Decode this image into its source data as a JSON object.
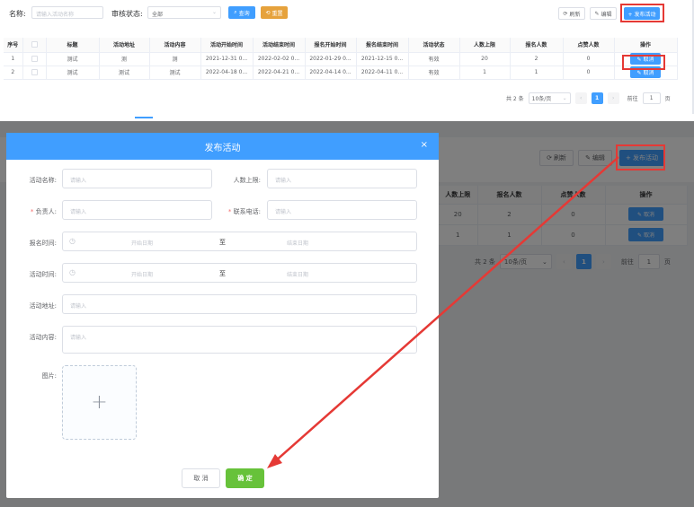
{
  "search": {
    "name_label": "名称:",
    "name_placeholder": "请输入活动名称",
    "status_label": "审核状态:",
    "status_value": "全部",
    "query_label": "查询",
    "reset_label": "重置"
  },
  "toolbar": {
    "refresh_label": "刷新",
    "edit_label": "编辑",
    "publish_label": "+ 发布活动"
  },
  "table": {
    "headers": [
      "序号",
      "",
      "标题",
      "活动地址",
      "活动内容",
      "活动开始时间",
      "活动结束时间",
      "报名开始时间",
      "报名结束时间",
      "活动状态",
      "人数上限",
      "报名人数",
      "点赞人数",
      "操作"
    ],
    "rows": [
      {
        "idx": "1",
        "title": "测试",
        "address": "测",
        "content": "测",
        "start": "2021-12-31 0...",
        "end": "2022-02-02 0...",
        "reg_start": "2022-01-29 0...",
        "reg_end": "2021-12-15 0...",
        "status": "有效",
        "limit": "20",
        "signed": "2",
        "likes": "0",
        "action": "取消"
      },
      {
        "idx": "2",
        "title": "测试",
        "address": "测试",
        "content": "测试",
        "start": "2022-04-18 0...",
        "end": "2022-04-21 0...",
        "reg_start": "2022-04-14 0...",
        "reg_end": "2022-04-11 0...",
        "status": "有效",
        "limit": "1",
        "signed": "1",
        "likes": "0",
        "action": "取消"
      }
    ]
  },
  "pager": {
    "total": "共 2 条",
    "page_size": "10条/页",
    "page": "1",
    "goto_label": "前往",
    "goto_value": "1",
    "goto_unit": "页"
  },
  "bg": {
    "refresh_label": "刷新",
    "edit_label": "编辑",
    "publish_label": "+ 发布活动",
    "headers": [
      "人数上限",
      "报名人数",
      "点赞人数",
      "操作"
    ],
    "rows": [
      {
        "limit": "20",
        "signed": "2",
        "likes": "0",
        "action": "取消"
      },
      {
        "limit": "1",
        "signed": "1",
        "likes": "0",
        "action": "取消"
      }
    ],
    "total": "共 2 条",
    "page_size": "10条/页",
    "page": "1",
    "goto_label": "前往",
    "goto_value": "1",
    "goto_unit": "页"
  },
  "dialog": {
    "title": "发布活动",
    "close": "×",
    "activity_name_label": "活动名称:",
    "max_people_label": "人数上限:",
    "owner_label": "负责人:",
    "phone_label": "联系电话:",
    "signup_time_label": "报名时间:",
    "activity_time_label": "活动时间:",
    "address_label": "活动地址:",
    "content_label": "活动内容:",
    "image_label": "图片:",
    "placeholder": "请输入",
    "start_date": "开始日期",
    "to": "至",
    "end_date": "结束日期",
    "upload_plus": "+",
    "cancel_label": "取 消",
    "confirm_label": "确 定"
  },
  "colors": {
    "primary": "#409eff",
    "warning": "#e6a23c",
    "success": "#67c23a",
    "annotation": "#e53935"
  }
}
